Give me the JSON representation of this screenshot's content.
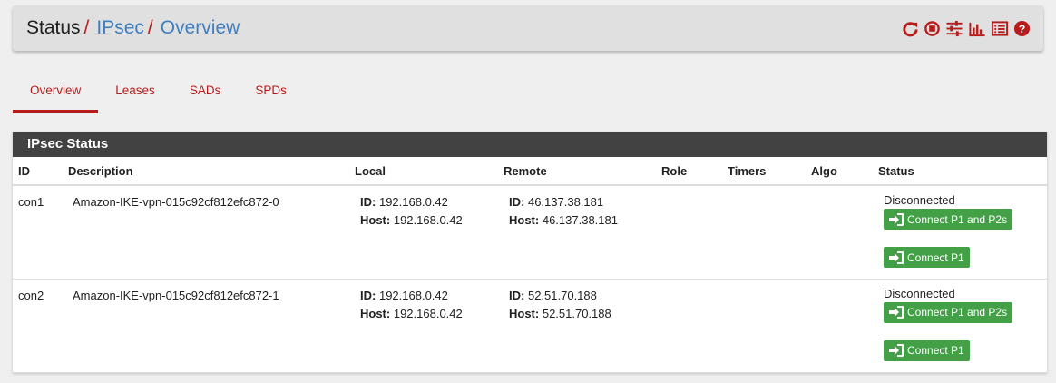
{
  "breadcrumb": {
    "root": "Status",
    "sep1": "/",
    "section": "IPsec",
    "sep2": "/",
    "page": "Overview"
  },
  "header_icons": [
    "reload-icon",
    "stop-icon",
    "sliders-icon",
    "bar-chart-icon",
    "list-icon",
    "help-icon"
  ],
  "tabs": [
    {
      "label": "Overview",
      "active": true
    },
    {
      "label": "Leases",
      "active": false
    },
    {
      "label": "SADs",
      "active": false
    },
    {
      "label": "SPDs",
      "active": false
    }
  ],
  "panel": {
    "title": "IPsec Status"
  },
  "columns": [
    "ID",
    "Description",
    "Local",
    "Remote",
    "Role",
    "Timers",
    "Algo",
    "Status"
  ],
  "rows": [
    {
      "id": "con1",
      "description": "Amazon-IKE-vpn-015c92cf812efc872-0",
      "local_id_label": "ID:",
      "local_id": "192.168.0.42",
      "local_host_label": "Host:",
      "local_host": "192.168.0.42",
      "remote_id_label": "ID:",
      "remote_id": "46.137.38.181",
      "remote_host_label": "Host:",
      "remote_host": "46.137.38.181",
      "status": "Disconnected",
      "btn_connect_both": "Connect P1 and P2s",
      "btn_connect_p1": "Connect P1"
    },
    {
      "id": "con2",
      "description": "Amazon-IKE-vpn-015c92cf812efc872-1",
      "local_id_label": "ID:",
      "local_id": "192.168.0.42",
      "local_host_label": "Host:",
      "local_host": "192.168.0.42",
      "remote_id_label": "ID:",
      "remote_id": "52.51.70.188",
      "remote_host_label": "Host:",
      "remote_host": "52.51.70.188",
      "status": "Disconnected",
      "btn_connect_both": "Connect P1 and P2s",
      "btn_connect_p1": "Connect P1"
    }
  ],
  "colors": {
    "accent": "#b71c1c",
    "link": "#3f7fc1",
    "success": "#43a047",
    "panel_heading": "#424242"
  }
}
